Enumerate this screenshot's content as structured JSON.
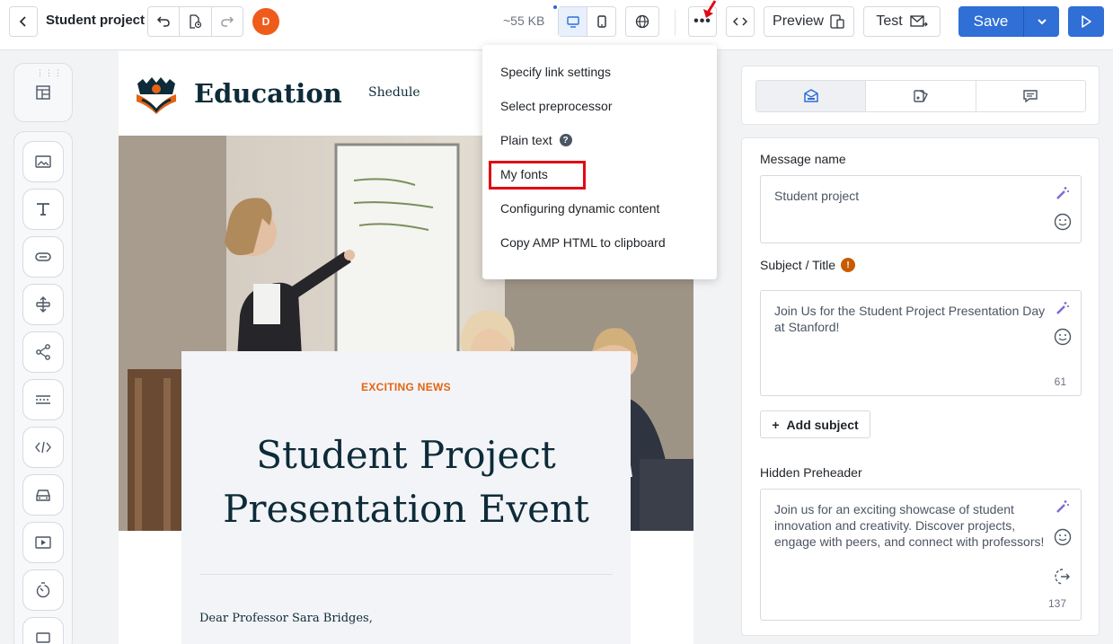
{
  "header": {
    "title": "Student project",
    "avatar_initial": "D",
    "size_label": "~55 KB",
    "more_label": "•••",
    "preview_label": "Preview",
    "test_label": "Test",
    "save_label": "Save"
  },
  "menu": {
    "items": [
      {
        "label": "Specify link settings"
      },
      {
        "label": "Select preprocessor"
      },
      {
        "label": "Plain text",
        "help": "?"
      },
      {
        "label": "My fonts"
      },
      {
        "label": "Configuring dynamic content"
      },
      {
        "label": "Copy AMP HTML to clipboard"
      }
    ]
  },
  "email": {
    "brand": "Education",
    "nav_link": "Shedule",
    "kicker": "EXCITING NEWS",
    "headline_line1": "Student Project",
    "headline_line2": "Presentation Event",
    "greeting": "Dear Professor Sara Bridges,"
  },
  "right_panel": {
    "message_name_label": "Message name",
    "message_name_value": "Student project",
    "subject_label": "Subject / Title",
    "subject_value": "Join Us for the Student Project Presentation Day at Stanford!",
    "subject_count": "61",
    "add_subject_label": "Add subject",
    "preheader_label": "Hidden Preheader",
    "preheader_value": "Join us for an exciting showcase of student innovation and creativity. Discover projects, engage with peers, and connect with professors!",
    "preheader_count": "137"
  },
  "colors": {
    "accent": "#2f6fd6",
    "highlight": "#e00b14",
    "kicker": "#e36414",
    "brand_text": "#0d2b38"
  },
  "tools": [
    "image-icon",
    "text-icon",
    "button-icon",
    "spacer-icon",
    "social-icon",
    "divider-icon",
    "html-icon",
    "menu-icon",
    "video-icon",
    "timer-icon"
  ]
}
